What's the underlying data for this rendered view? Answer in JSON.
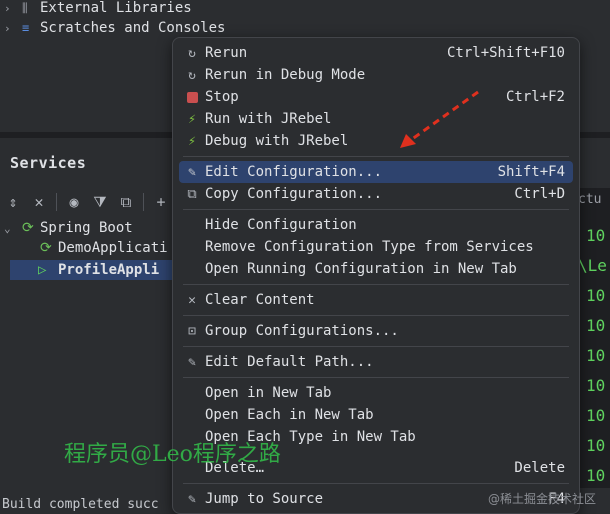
{
  "project_tree": [
    {
      "label": "External Libraries",
      "icon": "library-icon"
    },
    {
      "label": "Scratches and Consoles",
      "icon": "scratches-icon"
    }
  ],
  "services": {
    "title": "Services",
    "tree": {
      "group": "Spring Boot",
      "items": [
        "DemoApplicati",
        "ProfileAppli"
      ]
    }
  },
  "console": {
    "fragments": [
      "ctu",
      "\\Le"
    ],
    "numbers": [
      "10",
      "10",
      "10",
      "10",
      "10",
      "10",
      "10",
      "10",
      "10"
    ]
  },
  "status_text": "Build completed succ",
  "watermark": "程序员@Leo程序之路",
  "watermark2": "@稀土掘金技术社区",
  "menu": {
    "items": [
      {
        "label": "Rerun",
        "shortcut": "Ctrl+Shift+F10",
        "icon": "rerun-icon"
      },
      {
        "label": "Rerun in Debug Mode",
        "shortcut": "",
        "icon": "rerun-debug-icon"
      },
      {
        "label": "Stop",
        "shortcut": "Ctrl+F2",
        "icon": "stop-icon"
      },
      {
        "label": "Run with JRebel",
        "shortcut": "",
        "icon": "jrebel-run-icon"
      },
      {
        "label": "Debug with JRebel",
        "shortcut": "",
        "icon": "jrebel-debug-icon"
      },
      {
        "label": "Edit Configuration...",
        "shortcut": "Shift+F4",
        "icon": "edit-icon"
      },
      {
        "label": "Copy Configuration...",
        "shortcut": "Ctrl+D",
        "icon": "copy-icon"
      },
      {
        "label": "Hide Configuration",
        "shortcut": "",
        "icon": ""
      },
      {
        "label": "Remove Configuration Type from Services",
        "shortcut": "",
        "icon": ""
      },
      {
        "label": "Open Running Configuration in New Tab",
        "shortcut": "",
        "icon": ""
      },
      {
        "label": "Clear Content",
        "shortcut": "",
        "icon": "clear-icon"
      },
      {
        "label": "Group Configurations...",
        "shortcut": "",
        "icon": "folder-icon"
      },
      {
        "label": "Edit Default Path...",
        "shortcut": "",
        "icon": "edit-icon"
      },
      {
        "label": "Open in New Tab",
        "shortcut": "",
        "icon": ""
      },
      {
        "label": "Open Each in New Tab",
        "shortcut": "",
        "icon": ""
      },
      {
        "label": "Open Each Type in New Tab",
        "shortcut": "",
        "icon": ""
      },
      {
        "label": "Delete…",
        "shortcut": "Delete",
        "icon": ""
      },
      {
        "label": "Jump to Source",
        "shortcut": "F4",
        "icon": "jump-icon"
      }
    ]
  },
  "colors": {
    "selection": "#2e436e",
    "annotation_arrow": "#e0301e",
    "console_green": "#5fd35f"
  }
}
